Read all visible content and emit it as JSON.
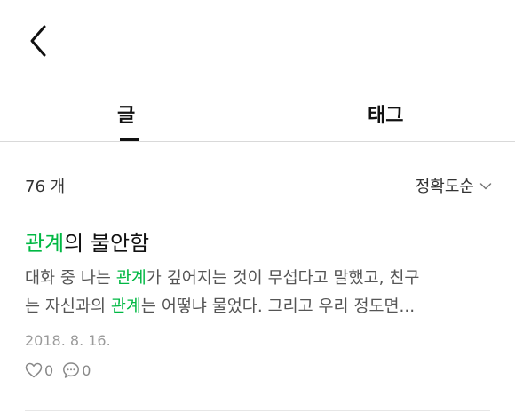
{
  "header": {
    "back_icon": "chevron-left-icon"
  },
  "tabs": [
    {
      "label": "글",
      "active": true
    },
    {
      "label": "태그",
      "active": false
    }
  ],
  "list_header": {
    "count": "76 개",
    "sort_label": "정확도순",
    "sort_icon": "chevron-down-icon"
  },
  "post": {
    "title_highlight": "관계",
    "title_rest": "의 불안함",
    "excerpt_line1": {
      "before": "대화 중 나는 ",
      "highlight": "관계",
      "after": "가 깊어지는 것이 무섭다고 말했고, 친구"
    },
    "excerpt_line2": {
      "before": "는 자신과의 ",
      "highlight": "관계",
      "after": "는 어떻냐 물었다. 그리고 우리 정도면..."
    },
    "date": "2018. 8. 16.",
    "likes": "0",
    "comments": "0"
  },
  "colors": {
    "highlight": "#00b843",
    "text": "#111111",
    "muted": "#9a9a9a",
    "divider": "#d9d9d9"
  }
}
